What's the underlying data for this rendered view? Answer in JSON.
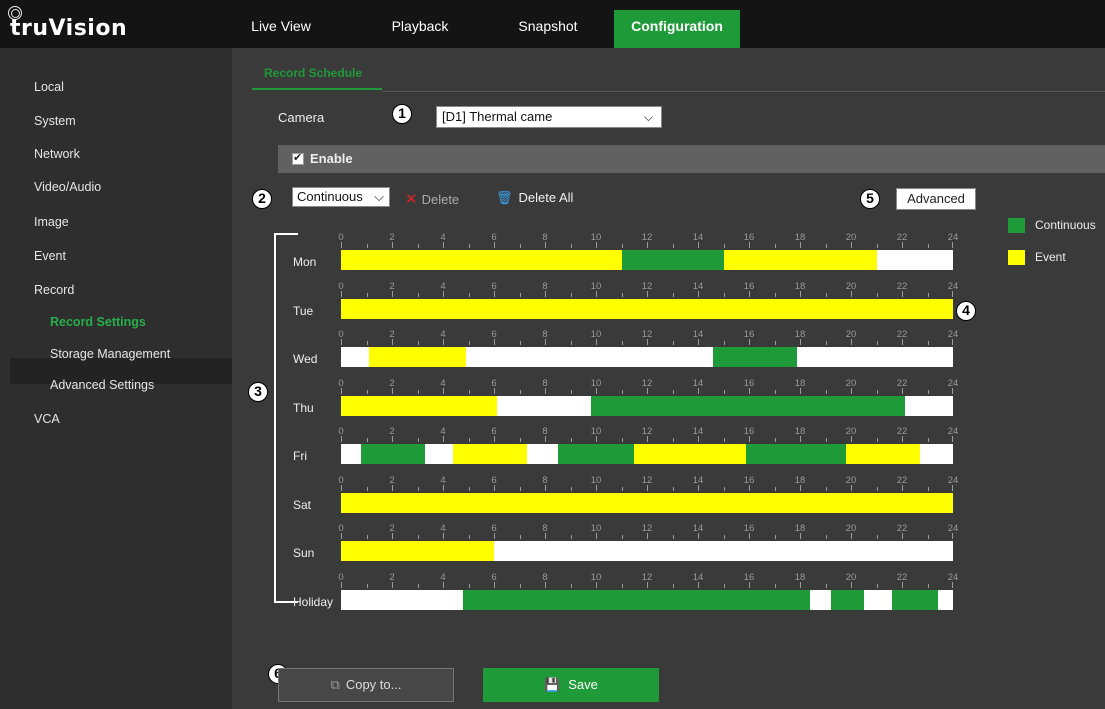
{
  "app": {
    "logo_text": "truVision"
  },
  "nav_tabs": [
    {
      "label": "Live View"
    },
    {
      "label": "Playback"
    },
    {
      "label": "Snapshot"
    },
    {
      "label": "Configuration",
      "active": true
    }
  ],
  "sidebar": {
    "items": [
      {
        "label": "Local"
      },
      {
        "label": "System"
      },
      {
        "label": "Network"
      },
      {
        "label": "Video/Audio"
      },
      {
        "label": "Image"
      },
      {
        "label": "Event"
      },
      {
        "label": "Record"
      },
      {
        "label": "Record Settings",
        "active": true
      },
      {
        "label": "Storage Management"
      },
      {
        "label": "Advanced Settings"
      },
      {
        "label": "VCA"
      }
    ]
  },
  "page": {
    "title": "Record Schedule"
  },
  "callouts": [
    "1",
    "2",
    "3",
    "4",
    "5",
    "6"
  ],
  "camera": {
    "label": "Camera",
    "value": "[D1] Thermal came"
  },
  "enable": {
    "label": "Enable",
    "checked": true
  },
  "toolbar": {
    "type_value": "Continuous",
    "delete_label": "Delete",
    "delete_all_label": "Delete All",
    "advanced_label": "Advanced"
  },
  "legend": [
    {
      "label": "Continuous",
      "color": "#1e9a38"
    },
    {
      "label": "Event",
      "color": "#ffff00"
    }
  ],
  "colors": {
    "continuous": "#1e9a38",
    "event": "#ffff00",
    "empty": "#ffffff",
    "accent": "#1e9a38"
  },
  "timeline_ticks": [
    "0",
    "2",
    "4",
    "6",
    "8",
    "10",
    "12",
    "14",
    "16",
    "18",
    "20",
    "22",
    "24"
  ],
  "schedule": [
    {
      "day": "Mon",
      "segments": [
        {
          "start": 0,
          "end": 11,
          "type": "event"
        },
        {
          "start": 11,
          "end": 15,
          "type": "continuous"
        },
        {
          "start": 15,
          "end": 21,
          "type": "event"
        }
      ]
    },
    {
      "day": "Tue",
      "segments": [
        {
          "start": 0,
          "end": 24,
          "type": "event"
        }
      ]
    },
    {
      "day": "Wed",
      "segments": [
        {
          "start": 1.1,
          "end": 4.9,
          "type": "event"
        },
        {
          "start": 14.6,
          "end": 17.9,
          "type": "continuous"
        }
      ]
    },
    {
      "day": "Thu",
      "segments": [
        {
          "start": 0,
          "end": 6.1,
          "type": "event"
        },
        {
          "start": 9.8,
          "end": 22.1,
          "type": "continuous"
        }
      ]
    },
    {
      "day": "Fri",
      "segments": [
        {
          "start": 0.8,
          "end": 3.3,
          "type": "continuous"
        },
        {
          "start": 4.4,
          "end": 7.3,
          "type": "event"
        },
        {
          "start": 8.5,
          "end": 11.5,
          "type": "continuous"
        },
        {
          "start": 11.5,
          "end": 15.9,
          "type": "event"
        },
        {
          "start": 15.9,
          "end": 19.8,
          "type": "continuous"
        },
        {
          "start": 19.8,
          "end": 22.7,
          "type": "event"
        }
      ]
    },
    {
      "day": "Sat",
      "segments": [
        {
          "start": 0,
          "end": 24,
          "type": "event"
        }
      ]
    },
    {
      "day": "Sun",
      "segments": [
        {
          "start": 0,
          "end": 6,
          "type": "event"
        }
      ]
    },
    {
      "day": "Holiday",
      "segments": [
        {
          "start": 4.8,
          "end": 18.4,
          "type": "continuous"
        },
        {
          "start": 19.2,
          "end": 20.5,
          "type": "continuous"
        },
        {
          "start": 21.6,
          "end": 23.4,
          "type": "continuous"
        }
      ]
    }
  ],
  "buttons": {
    "copy_label": "Copy to...",
    "save_label": "Save"
  }
}
